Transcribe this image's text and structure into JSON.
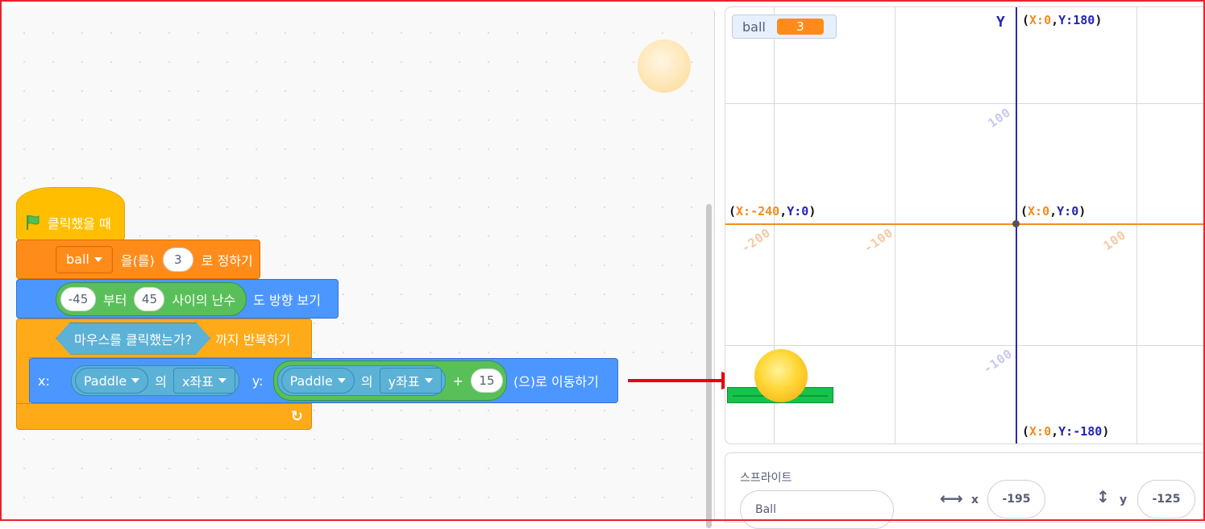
{
  "script": {
    "hat_label": "클릭했을 때",
    "set_var": {
      "variable": "ball",
      "verb": "을(를)",
      "value": "3",
      "suffix": "로 정하기"
    },
    "point_dir": {
      "from": "-45",
      "from_label": "부터",
      "to": "45",
      "to_label": "사이의 난수",
      "suffix": "도 방향 보기"
    },
    "repeat_until": {
      "condition": "마우스를 클릭했는가?",
      "suffix": "까지 반복하기"
    },
    "move": {
      "x_label": "x:",
      "x_sprite": "Paddle",
      "of_label_1": "의",
      "x_attr": "x좌표",
      "y_label": "y:",
      "y_sprite": "Paddle",
      "of_label_2": "의",
      "y_attr": "y좌표",
      "plus": "+",
      "offset": "15",
      "suffix": "(으)로 이동하기"
    },
    "loop_arrow": "↻"
  },
  "stage": {
    "monitor": {
      "name": "ball",
      "value": "3"
    },
    "y_axis_label": "Y",
    "coords": {
      "top": {
        "prefix": "(",
        "x_part": "X:0",
        "comma": ",",
        "y_part": "Y:180",
        "suffix": ")"
      },
      "left": {
        "prefix": "(",
        "x_part": "X:-240",
        "comma": ",",
        "y_part": "Y:0",
        "suffix": ")"
      },
      "origin": {
        "prefix": "(",
        "x_part": "X:0",
        "comma": ",",
        "y_part": "Y:0",
        "suffix": ")"
      },
      "bottom": {
        "prefix": "(",
        "x_part": "X:0",
        "comma": ",",
        "y_part": "Y:-180",
        "suffix": ")"
      }
    },
    "ticks": {
      "x_neg200": "-200",
      "x_neg100": "-100",
      "x_100": "100",
      "y_100": "100",
      "y_neg100": "-100"
    }
  },
  "sprite_info": {
    "title": "스프라이트",
    "name": "Ball",
    "x_label": "x",
    "x_value": "-195",
    "y_label": "y",
    "y_value": "-125"
  },
  "colors": {
    "events": "#ffbf00",
    "variables": "#ff8c1a",
    "motion": "#4c97ff",
    "control": "#ffab19",
    "operators": "#59c059",
    "sensing": "#5cb1d6",
    "annotation_arrow": "#e8000b"
  }
}
